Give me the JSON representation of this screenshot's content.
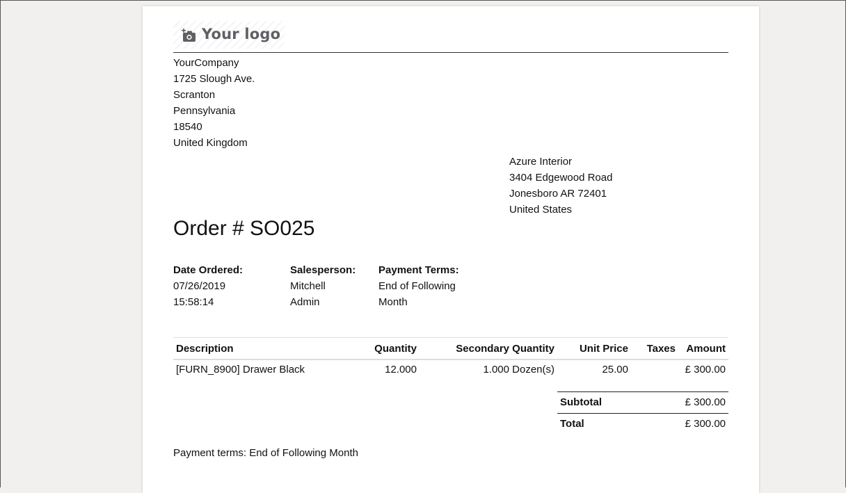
{
  "logo": {
    "text": "Your logo",
    "icon": "camera-plus-icon"
  },
  "company": {
    "name": "YourCompany",
    "street": "1725 Slough Ave.",
    "city": "Scranton",
    "state": "Pennsylvania",
    "zip": "18540",
    "country": "United Kingdom"
  },
  "partner": {
    "name": "Azure Interior",
    "street": "3404 Edgewood Road",
    "city_line": "Jonesboro AR 72401",
    "country": "United States"
  },
  "order": {
    "title": "Order # SO025"
  },
  "info": {
    "date_label": "Date Ordered:",
    "date_value": "07/26/2019",
    "time_value": "15:58:14",
    "salesperson_label": "Salesperson:",
    "salesperson_first": "Mitchell",
    "salesperson_last": "Admin",
    "terms_label": "Payment Terms:",
    "terms_line1": "End of Following",
    "terms_line2": "Month"
  },
  "table": {
    "headers": [
      "Description",
      "Quantity",
      "Secondary Quantity",
      "Unit Price",
      "Taxes",
      "Amount"
    ],
    "rows": [
      [
        "[FURN_8900] Drawer Black",
        "12.000",
        "1.000 Dozen(s)",
        "25.00",
        "",
        "£ 300.00"
      ]
    ]
  },
  "totals": {
    "subtotal_label": "Subtotal",
    "subtotal_value": "£ 300.00",
    "total_label": "Total",
    "total_value": "£ 300.00"
  },
  "note": "Payment terms: End of Following Month"
}
